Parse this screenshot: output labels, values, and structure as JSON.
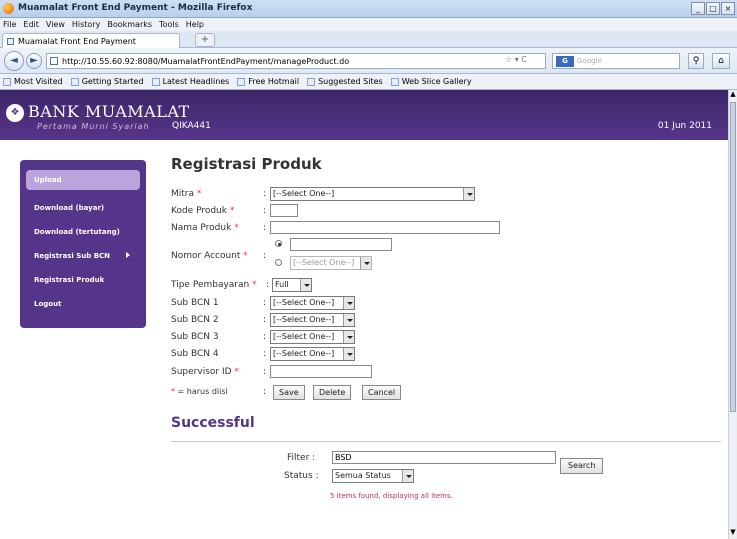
{
  "window": {
    "title": "Muamalat Front End Payment - Mozilla Firefox",
    "min": "_",
    "max": "□",
    "close": "×"
  },
  "menu": [
    "File",
    "Edit",
    "View",
    "History",
    "Bookmarks",
    "Tools",
    "Help"
  ],
  "tab": {
    "label": "Muamalat Front End Payment",
    "newtab": "+"
  },
  "nav": {
    "back": "◄",
    "forward": "►",
    "url": "http://10.55.60.92:8080/MuamalatFrontEndPayment/manageProduct.do",
    "search_placeholder": "Google",
    "search_engine": "G",
    "ctl": "☆ ▾ C"
  },
  "bookmarks": [
    "Most Visited",
    "Getting Started",
    "Latest Headlines",
    "Free Hotmail",
    "Suggested Sites",
    "Web Slice Gallery"
  ],
  "header": {
    "brand": "BANK MUAMALAT",
    "tagline": "Pertama Murni Syariah",
    "user": "QIKA441",
    "date": "01 Jun 2011"
  },
  "sidebar": [
    "Upload",
    "Download (bayar)",
    "Download (tertutang)",
    "Registrasi Sub BCN",
    "Registrasi Produk",
    "Logout"
  ],
  "form": {
    "title": "Registrasi Produk",
    "labels": {
      "mitra": "Mitra",
      "kode": "Kode Produk",
      "nama": "Nama Produk",
      "nomor": "Nomor Account",
      "tipe": "Tipe Pembayaran",
      "sub1": "Sub BCN 1",
      "sub2": "Sub BCN 2",
      "sub3": "Sub BCN 3",
      "sub4": "Sub BCN 4",
      "supervisor": "Supervisor ID"
    },
    "star": "*",
    "colon": ":",
    "select_one": "[--Select One--]",
    "tipe_value": "Full",
    "required_note": "= harus diisi",
    "buttons": {
      "save": "Save",
      "delete": "Delete",
      "cancel": "Cancel"
    }
  },
  "result": {
    "status": "Successful"
  },
  "filter": {
    "filter_label": "Filter",
    "filter_value": "BSD",
    "status_label": "Status",
    "status_value": "Semua Status",
    "search": "Search",
    "found": "5 items found, displaying all items."
  }
}
